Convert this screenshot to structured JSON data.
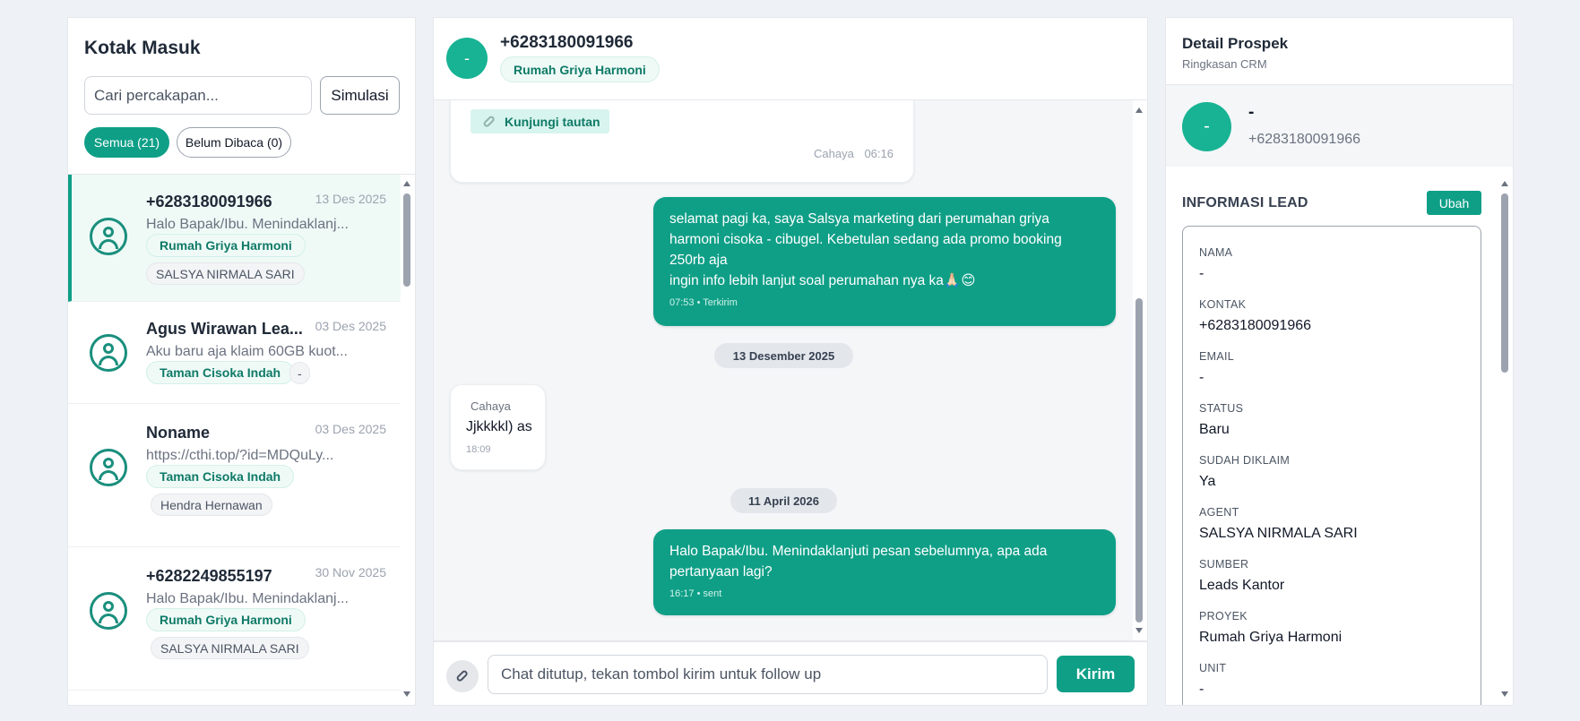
{
  "inbox": {
    "title": "Kotak Masuk",
    "search_placeholder": "Cari percakapan...",
    "simulate_label": "Simulasi",
    "filter_all": "Semua (21)",
    "filter_unread": "Belum Dibaca (0)",
    "conversations": [
      {
        "name": "+6283180091966",
        "date": "13 Des 2025",
        "preview": "Halo Bapak/Ibu. Menindaklanj...",
        "project": "Rumah Griya Harmoni",
        "agent": "SALSYA NIRMALA SARI"
      },
      {
        "name": "Agus Wirawan Lea...",
        "date": "03 Des 2025",
        "preview": "Aku baru aja klaim 60GB kuot...",
        "project": "Taman Cisoka Indah",
        "agent": "-"
      },
      {
        "name": "Noname",
        "date": "03 Des 2025",
        "preview": "https://cthi.top/?id=MDQuLy...",
        "project": "Taman Cisoka Indah",
        "agent": "Hendra Hernawan"
      },
      {
        "name": "+6282249855197",
        "date": "30 Nov 2025",
        "preview": "Halo Bapak/Ibu. Menindaklanj...",
        "project": "Rumah Griya Harmoni",
        "agent": "SALSYA NIRMALA SARI"
      }
    ]
  },
  "chat": {
    "avatar_initial": "-",
    "phone": "+6283180091966",
    "project": "Rumah Griya Harmoni",
    "link_label": "Kunjungi tautan",
    "msg1_sender": "Cahaya",
    "msg1_time": "06:16",
    "msg2_line1": "selamat pagi ka, saya Salsya marketing dari perumahan griya",
    "msg2_line2": "harmoni cisoka - cibugel. Kebetulan sedang ada promo booking",
    "msg2_line3": "250rb aja",
    "msg2_line4": "ingin info lebih lanjut soal perumahan nya ka🙏🏻😊",
    "msg2_meta": "07:53 • Terkirim",
    "date1": "13 Desember 2025",
    "msg3_sender": "Cahaya",
    "msg3_text": "Jjkkkkl) as",
    "msg3_time": "18:09",
    "date2": "11 April 2026",
    "msg4_line1": "Halo Bapak/Ibu. Menindaklanjuti pesan sebelumnya, apa ada",
    "msg4_line2": "pertanyaan lagi?",
    "msg4_meta": "16:17 • sent",
    "composer_placeholder": "Chat ditutup, tekan tombol kirim untuk follow up",
    "send_label": "Kirim"
  },
  "detail": {
    "title": "Detail Prospek",
    "subtitle": "Ringkasan CRM",
    "avatar_initial": "-",
    "name": "-",
    "phone": "+6283180091966",
    "section_title": "INFORMASI LEAD",
    "edit_label": "Ubah",
    "fields": [
      {
        "label": "NAMA",
        "value": "-"
      },
      {
        "label": "KONTAK",
        "value": "+6283180091966"
      },
      {
        "label": "EMAIL",
        "value": "-"
      },
      {
        "label": "STATUS",
        "value": "Baru"
      },
      {
        "label": "SUDAH DIKLAIM",
        "value": "Ya"
      },
      {
        "label": "AGENT",
        "value": "SALSYA NIRMALA SARI"
      },
      {
        "label": "SUMBER",
        "value": "Leads Kantor"
      },
      {
        "label": "PROYEK",
        "value": "Rumah Griya Harmoni"
      },
      {
        "label": "UNIT",
        "value": "-"
      }
    ]
  },
  "colors": {
    "accent": "#0f9f87",
    "avatar_bg": "#17b394",
    "page_bg": "#eef2f6"
  }
}
